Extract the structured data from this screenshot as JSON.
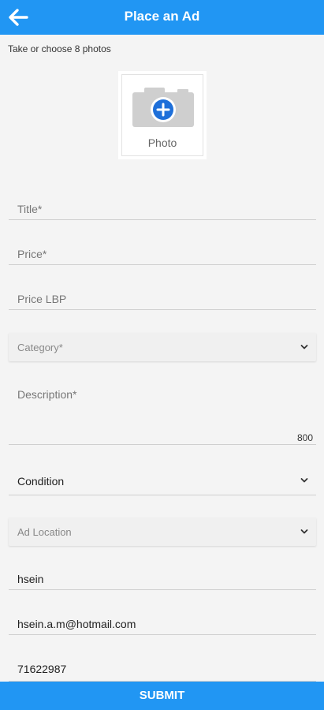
{
  "appbar": {
    "title": "Place an Ad",
    "back_icon": "arrow-left-icon"
  },
  "photos": {
    "hint": "Take or choose 8 photos",
    "add_label": "Photo",
    "camera_icon": "camera-plus-icon"
  },
  "form": {
    "title": {
      "placeholder": "Title*",
      "value": ""
    },
    "price": {
      "placeholder": "Price*",
      "value": ""
    },
    "price_lbp": {
      "placeholder": "Price LBP",
      "value": ""
    },
    "category": {
      "placeholder": "Category*",
      "value": ""
    },
    "description": {
      "placeholder": "Description*",
      "value": "",
      "counter": "800"
    },
    "condition": {
      "selected": "Condition"
    },
    "location": {
      "placeholder": "Ad Location",
      "value": ""
    },
    "name": {
      "value": "hsein"
    },
    "email": {
      "value": "hsein.a.m@hotmail.com"
    },
    "phone": {
      "value": "71622987"
    }
  },
  "actions": {
    "submit": "SUBMIT"
  },
  "colors": {
    "primary": "#2196f3",
    "background": "#f4f4f4"
  }
}
